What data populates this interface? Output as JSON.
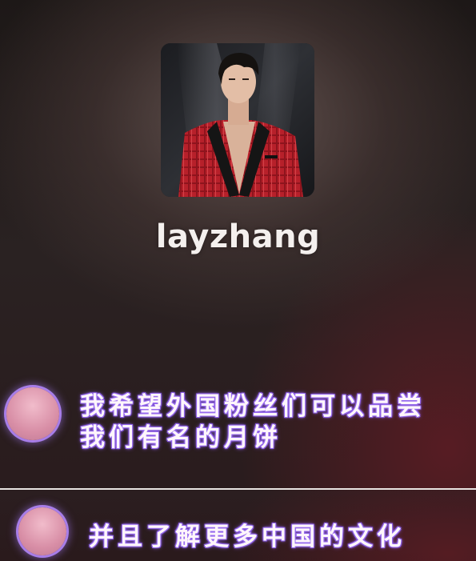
{
  "player": {
    "artist_name": "layzhang",
    "cover_image": "artist-portrait-red-suit"
  },
  "subtitles": [
    {
      "lines": [
        "我希望外国粉丝们可以品尝",
        "我们有名的月饼"
      ]
    },
    {
      "lines": [
        "并且了解更多中国的文化"
      ]
    }
  ],
  "colors": {
    "subtitle_glow": "#9a6ff0",
    "bubble": "#d88ea6",
    "suit_red": "#b7202a"
  }
}
